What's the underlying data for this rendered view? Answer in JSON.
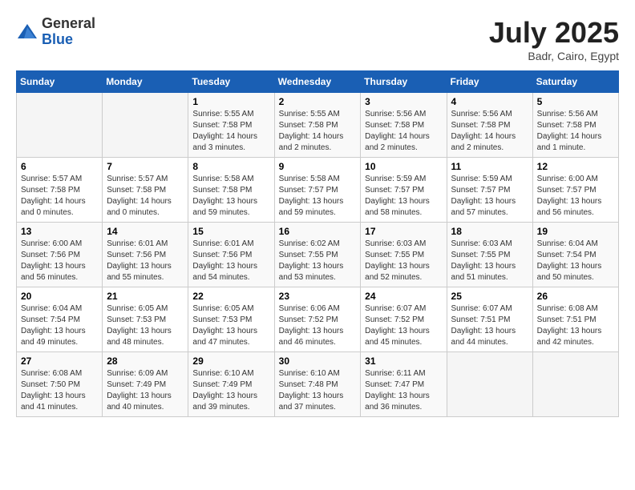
{
  "header": {
    "logo": {
      "general": "General",
      "blue": "Blue"
    },
    "title": "July 2025",
    "location": "Badr, Cairo, Egypt"
  },
  "weekdays": [
    "Sunday",
    "Monday",
    "Tuesday",
    "Wednesday",
    "Thursday",
    "Friday",
    "Saturday"
  ],
  "weeks": [
    [
      {
        "day": "",
        "sunrise": "",
        "sunset": "",
        "daylight": ""
      },
      {
        "day": "",
        "sunrise": "",
        "sunset": "",
        "daylight": ""
      },
      {
        "day": "1",
        "sunrise": "Sunrise: 5:55 AM",
        "sunset": "Sunset: 7:58 PM",
        "daylight": "Daylight: 14 hours and 3 minutes."
      },
      {
        "day": "2",
        "sunrise": "Sunrise: 5:55 AM",
        "sunset": "Sunset: 7:58 PM",
        "daylight": "Daylight: 14 hours and 2 minutes."
      },
      {
        "day": "3",
        "sunrise": "Sunrise: 5:56 AM",
        "sunset": "Sunset: 7:58 PM",
        "daylight": "Daylight: 14 hours and 2 minutes."
      },
      {
        "day": "4",
        "sunrise": "Sunrise: 5:56 AM",
        "sunset": "Sunset: 7:58 PM",
        "daylight": "Daylight: 14 hours and 2 minutes."
      },
      {
        "day": "5",
        "sunrise": "Sunrise: 5:56 AM",
        "sunset": "Sunset: 7:58 PM",
        "daylight": "Daylight: 14 hours and 1 minute."
      }
    ],
    [
      {
        "day": "6",
        "sunrise": "Sunrise: 5:57 AM",
        "sunset": "Sunset: 7:58 PM",
        "daylight": "Daylight: 14 hours and 0 minutes."
      },
      {
        "day": "7",
        "sunrise": "Sunrise: 5:57 AM",
        "sunset": "Sunset: 7:58 PM",
        "daylight": "Daylight: 14 hours and 0 minutes."
      },
      {
        "day": "8",
        "sunrise": "Sunrise: 5:58 AM",
        "sunset": "Sunset: 7:58 PM",
        "daylight": "Daylight: 13 hours and 59 minutes."
      },
      {
        "day": "9",
        "sunrise": "Sunrise: 5:58 AM",
        "sunset": "Sunset: 7:57 PM",
        "daylight": "Daylight: 13 hours and 59 minutes."
      },
      {
        "day": "10",
        "sunrise": "Sunrise: 5:59 AM",
        "sunset": "Sunset: 7:57 PM",
        "daylight": "Daylight: 13 hours and 58 minutes."
      },
      {
        "day": "11",
        "sunrise": "Sunrise: 5:59 AM",
        "sunset": "Sunset: 7:57 PM",
        "daylight": "Daylight: 13 hours and 57 minutes."
      },
      {
        "day": "12",
        "sunrise": "Sunrise: 6:00 AM",
        "sunset": "Sunset: 7:57 PM",
        "daylight": "Daylight: 13 hours and 56 minutes."
      }
    ],
    [
      {
        "day": "13",
        "sunrise": "Sunrise: 6:00 AM",
        "sunset": "Sunset: 7:56 PM",
        "daylight": "Daylight: 13 hours and 56 minutes."
      },
      {
        "day": "14",
        "sunrise": "Sunrise: 6:01 AM",
        "sunset": "Sunset: 7:56 PM",
        "daylight": "Daylight: 13 hours and 55 minutes."
      },
      {
        "day": "15",
        "sunrise": "Sunrise: 6:01 AM",
        "sunset": "Sunset: 7:56 PM",
        "daylight": "Daylight: 13 hours and 54 minutes."
      },
      {
        "day": "16",
        "sunrise": "Sunrise: 6:02 AM",
        "sunset": "Sunset: 7:55 PM",
        "daylight": "Daylight: 13 hours and 53 minutes."
      },
      {
        "day": "17",
        "sunrise": "Sunrise: 6:03 AM",
        "sunset": "Sunset: 7:55 PM",
        "daylight": "Daylight: 13 hours and 52 minutes."
      },
      {
        "day": "18",
        "sunrise": "Sunrise: 6:03 AM",
        "sunset": "Sunset: 7:55 PM",
        "daylight": "Daylight: 13 hours and 51 minutes."
      },
      {
        "day": "19",
        "sunrise": "Sunrise: 6:04 AM",
        "sunset": "Sunset: 7:54 PM",
        "daylight": "Daylight: 13 hours and 50 minutes."
      }
    ],
    [
      {
        "day": "20",
        "sunrise": "Sunrise: 6:04 AM",
        "sunset": "Sunset: 7:54 PM",
        "daylight": "Daylight: 13 hours and 49 minutes."
      },
      {
        "day": "21",
        "sunrise": "Sunrise: 6:05 AM",
        "sunset": "Sunset: 7:53 PM",
        "daylight": "Daylight: 13 hours and 48 minutes."
      },
      {
        "day": "22",
        "sunrise": "Sunrise: 6:05 AM",
        "sunset": "Sunset: 7:53 PM",
        "daylight": "Daylight: 13 hours and 47 minutes."
      },
      {
        "day": "23",
        "sunrise": "Sunrise: 6:06 AM",
        "sunset": "Sunset: 7:52 PM",
        "daylight": "Daylight: 13 hours and 46 minutes."
      },
      {
        "day": "24",
        "sunrise": "Sunrise: 6:07 AM",
        "sunset": "Sunset: 7:52 PM",
        "daylight": "Daylight: 13 hours and 45 minutes."
      },
      {
        "day": "25",
        "sunrise": "Sunrise: 6:07 AM",
        "sunset": "Sunset: 7:51 PM",
        "daylight": "Daylight: 13 hours and 44 minutes."
      },
      {
        "day": "26",
        "sunrise": "Sunrise: 6:08 AM",
        "sunset": "Sunset: 7:51 PM",
        "daylight": "Daylight: 13 hours and 42 minutes."
      }
    ],
    [
      {
        "day": "27",
        "sunrise": "Sunrise: 6:08 AM",
        "sunset": "Sunset: 7:50 PM",
        "daylight": "Daylight: 13 hours and 41 minutes."
      },
      {
        "day": "28",
        "sunrise": "Sunrise: 6:09 AM",
        "sunset": "Sunset: 7:49 PM",
        "daylight": "Daylight: 13 hours and 40 minutes."
      },
      {
        "day": "29",
        "sunrise": "Sunrise: 6:10 AM",
        "sunset": "Sunset: 7:49 PM",
        "daylight": "Daylight: 13 hours and 39 minutes."
      },
      {
        "day": "30",
        "sunrise": "Sunrise: 6:10 AM",
        "sunset": "Sunset: 7:48 PM",
        "daylight": "Daylight: 13 hours and 37 minutes."
      },
      {
        "day": "31",
        "sunrise": "Sunrise: 6:11 AM",
        "sunset": "Sunset: 7:47 PM",
        "daylight": "Daylight: 13 hours and 36 minutes."
      },
      {
        "day": "",
        "sunrise": "",
        "sunset": "",
        "daylight": ""
      },
      {
        "day": "",
        "sunrise": "",
        "sunset": "",
        "daylight": ""
      }
    ]
  ]
}
